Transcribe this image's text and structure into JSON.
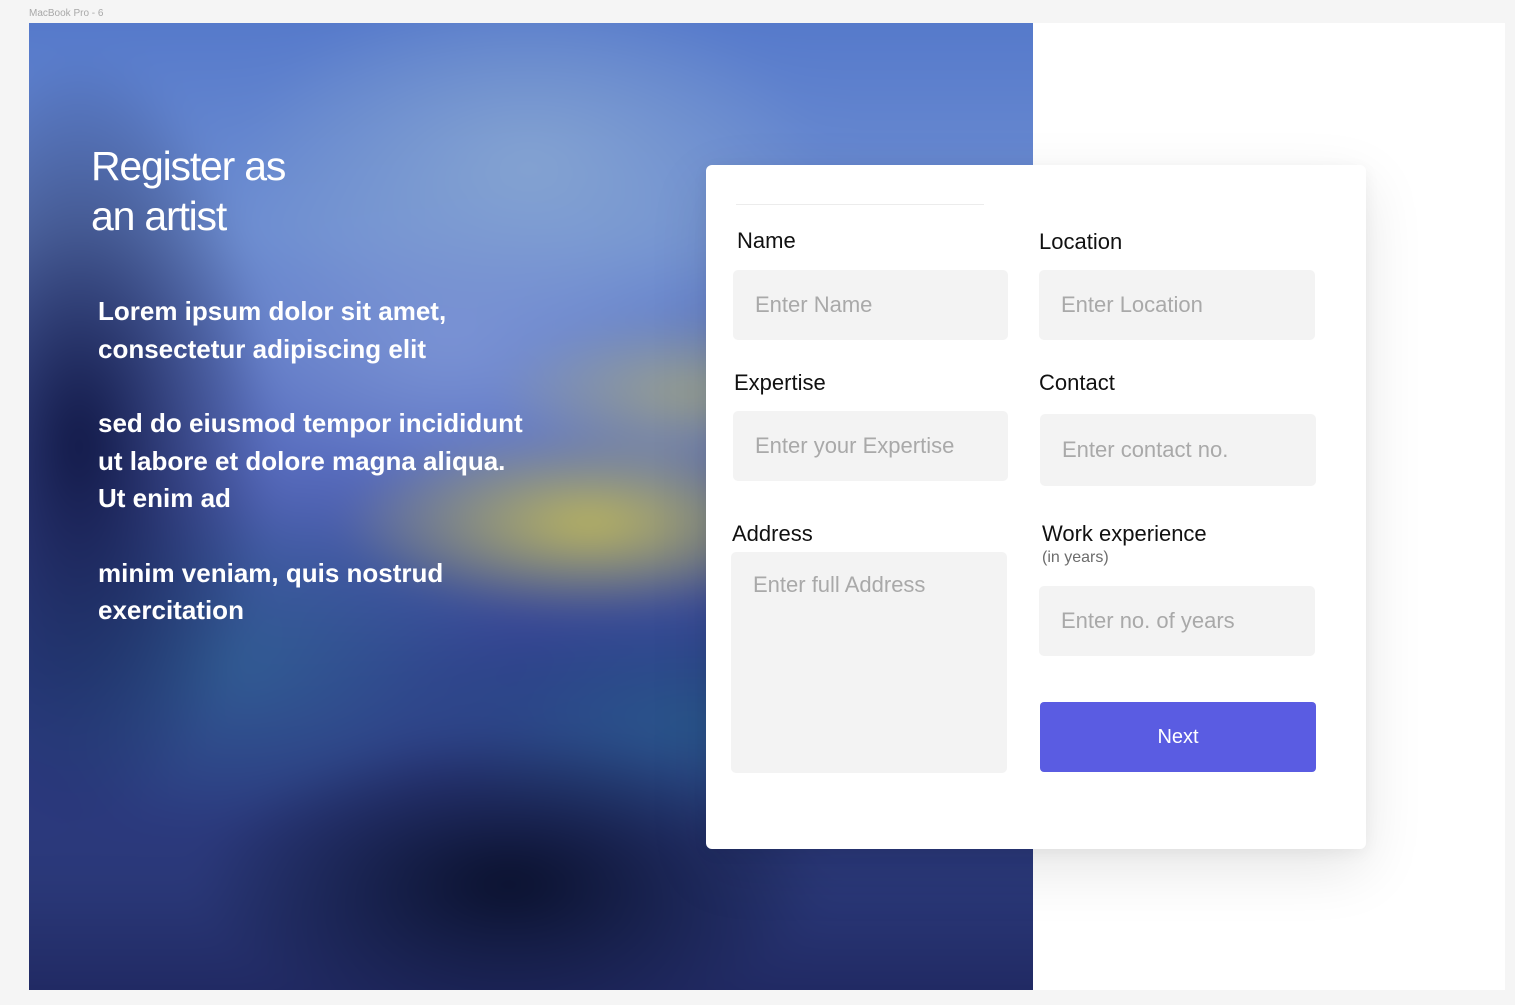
{
  "frame_label": "MacBook Pro - 6",
  "hero": {
    "title": "Register as\nan artist",
    "paragraphs": [
      "Lorem ipsum dolor sit amet, consectetur adipiscing elit",
      "sed do eiusmod tempor incididunt ut labore et dolore magna aliqua. Ut enim ad",
      "minim veniam, quis nostrud exercitation"
    ]
  },
  "form": {
    "name": {
      "label": "Name",
      "placeholder": "Enter Name"
    },
    "location": {
      "label": "Location",
      "placeholder": "Enter Location"
    },
    "expertise": {
      "label": "Expertise",
      "placeholder": "Enter your Expertise"
    },
    "contact": {
      "label": "Contact",
      "placeholder": "Enter contact no."
    },
    "address": {
      "label": "Address",
      "placeholder": "Enter full Address"
    },
    "experience": {
      "label": "Work experience",
      "sublabel": "(in years)",
      "placeholder": "Enter no. of years"
    },
    "next_label": "Next"
  },
  "colors": {
    "accent": "#5a5ce2",
    "input_bg": "#f3f3f3"
  }
}
